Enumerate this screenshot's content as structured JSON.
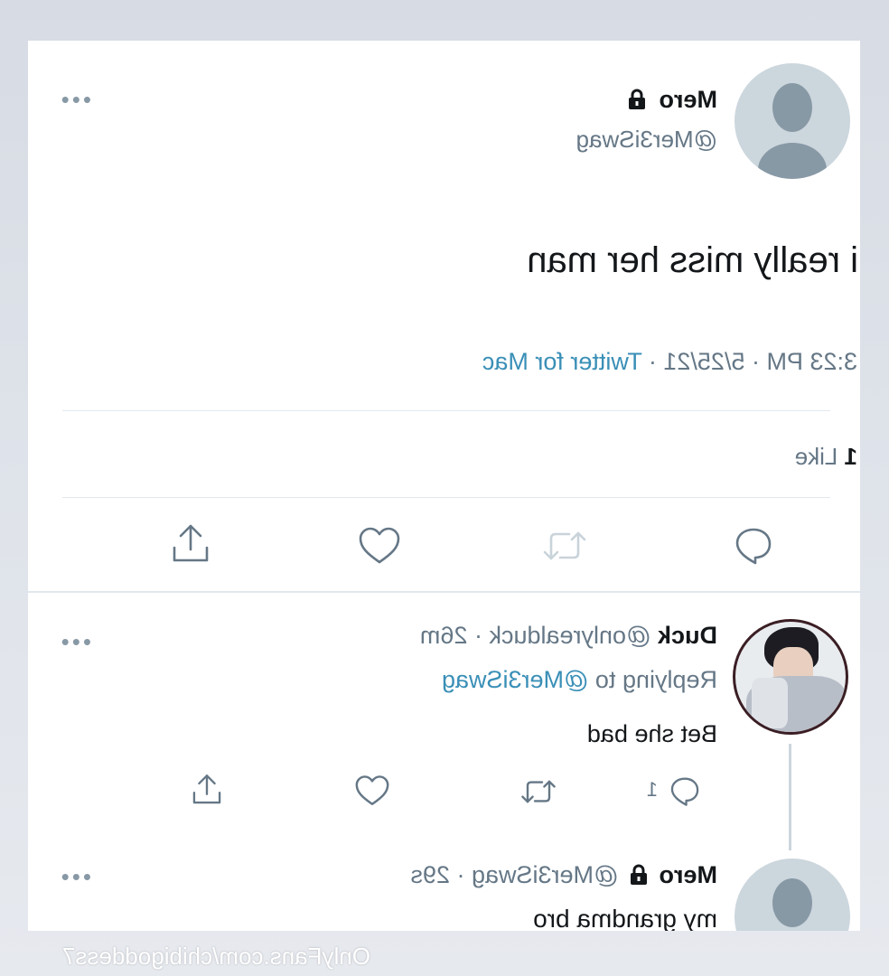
{
  "tweet": {
    "display_name": "Mero",
    "handle": "@Mer3iSwag",
    "text": "i really miss her man",
    "time": "3:23 PM · 5/25/21 · ",
    "source": "Twitter for Mac",
    "likes_count": "1",
    "likes_label": " Like",
    "more_icon": "more-icon"
  },
  "replies": [
    {
      "display_name": "Duck",
      "handle_time": "@onlyrealduck · 26m",
      "replying_prefix": "Replying to ",
      "replying_to": "@Mer3iSwag",
      "text": "Bet she bad",
      "reply_count": "1"
    },
    {
      "display_name": "Mero",
      "handle_time": "@Mer3iSwag · 29s",
      "text": "my grandma bro"
    }
  ],
  "watermark": "OnlyFans.com/chibigoddess7",
  "colors": {
    "link": "#3a8fb7",
    "muted": "#657786",
    "avatar_bg": "#ccd6dd",
    "avatar_fg": "#8899a6"
  }
}
